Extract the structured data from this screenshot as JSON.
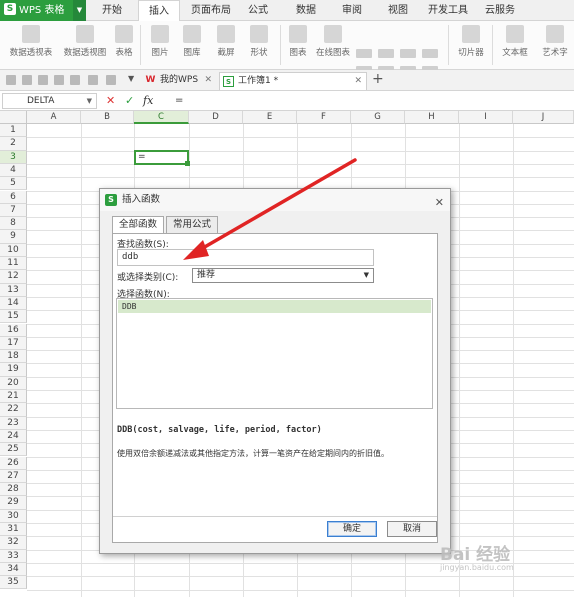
{
  "app": {
    "name": "WPS 表格",
    "logo": "S"
  },
  "menu_tabs": [
    "开始",
    "插入",
    "页面布局",
    "公式",
    "数据",
    "审阅",
    "视图",
    "开发工具",
    "云服务"
  ],
  "active_menu_tab": "插入",
  "ribbon": {
    "pivot_table": "数据透视表",
    "pivot_chart": "数据透视图",
    "table": "表格",
    "picture": "图片",
    "gallery": "图库",
    "screenshot": "截屏",
    "shapes": "形状",
    "chart": "图表",
    "online_chart": "在线图表",
    "slicer": "切片器",
    "textbox": "文本框",
    "art_text": "艺术字"
  },
  "doc_tabs": [
    {
      "label": "我的WPS",
      "icon": "wps-logo-icon"
    },
    {
      "label": "工作簿1 *",
      "icon": "sheet-icon"
    }
  ],
  "formula_bar": {
    "name_box": "DELTA",
    "cancel": "✕",
    "enter": "✓",
    "fx": "fx",
    "content": "="
  },
  "columns": [
    "A",
    "B",
    "C",
    "D",
    "E",
    "F",
    "G",
    "H",
    "I",
    "J"
  ],
  "rows": [
    "1",
    "2",
    "3",
    "4",
    "5",
    "6",
    "7",
    "8",
    "9",
    "10",
    "11",
    "12",
    "13",
    "14",
    "15",
    "16",
    "17",
    "18",
    "19",
    "20",
    "21",
    "22",
    "23",
    "24",
    "25",
    "26",
    "27",
    "28",
    "29",
    "30",
    "31",
    "32",
    "33",
    "34",
    "35"
  ],
  "active_cell": {
    "column": "C",
    "row": "3",
    "value": "="
  },
  "dialog": {
    "title": "插入函数",
    "tab_all": "全部函数",
    "tab_common": "常用公式",
    "search_label": "查找函数(S):",
    "search_value": "ddb",
    "category_label": "或选择类别(C):",
    "category_value": "推荐",
    "function_label": "选择函数(N):",
    "functions": [
      "DDB"
    ],
    "syntax": "DDB(cost, salvage, life, period, factor)",
    "description": "使用双倍余额递减法或其他指定方法，计算一笔资产在给定期间内的折旧值。",
    "ok": "确定",
    "cancel": "取消"
  },
  "watermark": {
    "text": "Bai 经验",
    "sub": "jingyan.baidu.com"
  },
  "colors": {
    "accent": "#2c9e3e",
    "arrow": "#e02424",
    "selection": "#d7e9cc"
  }
}
